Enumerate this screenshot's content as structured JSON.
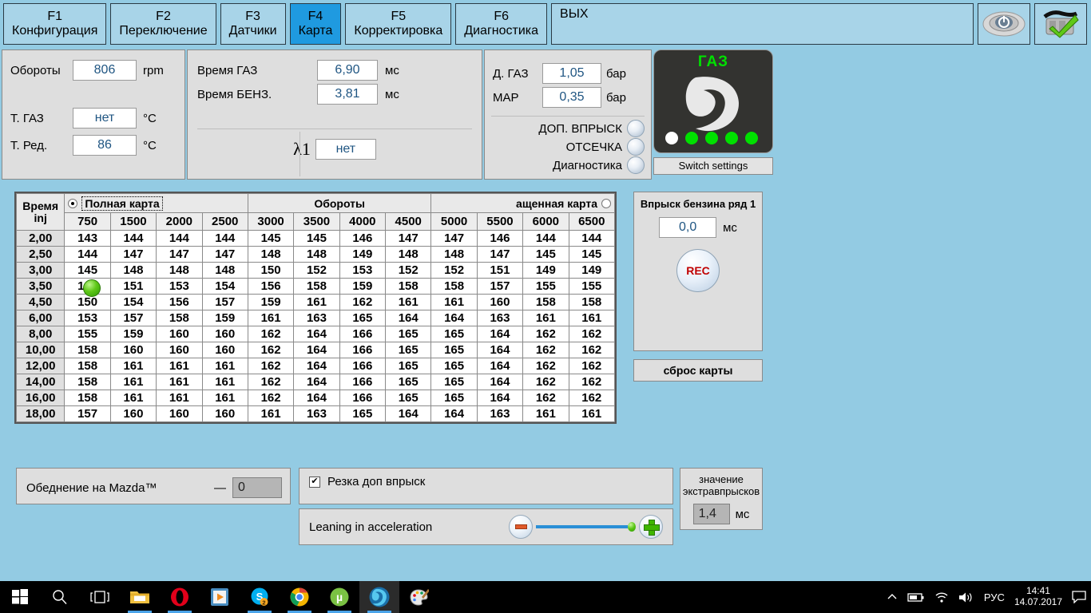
{
  "tabs": [
    {
      "fkey": "F1",
      "name": "Конфигурация",
      "selected": false
    },
    {
      "fkey": "F2",
      "name": "Переключение",
      "selected": false
    },
    {
      "fkey": "F3",
      "name": "Датчики",
      "selected": false
    },
    {
      "fkey": "F4",
      "name": "Карта",
      "selected": true
    },
    {
      "fkey": "F5",
      "name": "Корректировка",
      "selected": false
    },
    {
      "fkey": "F6",
      "name": "Диагностика",
      "selected": false
    }
  ],
  "exit_tab": {
    "label": "ВЫХ"
  },
  "toolbar_icons": [
    {
      "name": "power-button-icon"
    },
    {
      "name": "connector-ok-icon"
    }
  ],
  "params": {
    "rpm": {
      "label": "Обороты",
      "value": "806",
      "unit": "rpm"
    },
    "t_gas": {
      "label": "Т. ГАЗ",
      "value": "нет",
      "unit": "°C"
    },
    "t_red": {
      "label": "Т. Ред.",
      "value": "86",
      "unit": "°C"
    },
    "time_gas": {
      "label": "Время ГАЗ",
      "value": "6,90",
      "unit": "мс"
    },
    "time_petrol": {
      "label": "Время БЕНЗ.",
      "value": "3,81",
      "unit": "мс"
    },
    "lambda": {
      "label": "λ1",
      "value": "нет"
    },
    "p_gas": {
      "label": "Д. ГАЗ",
      "value": "1,05",
      "unit": "бар"
    },
    "map": {
      "label": "МАР",
      "value": "0,35",
      "unit": "бар"
    },
    "lamps": [
      {
        "label": "ДОП. ВПРЫСК",
        "on": false
      },
      {
        "label": "ОТСЕЧКА",
        "on": false
      },
      {
        "label": "Диагностика",
        "on": false
      }
    ]
  },
  "gas_panel": {
    "title": "ГАЗ",
    "logo_icon": "gas-leaf-logo-icon",
    "leds": [
      "white",
      "green",
      "green",
      "green",
      "green"
    ],
    "switch_button": "Switch settings"
  },
  "map_table": {
    "corner_line1": "Время",
    "corner_line2": "inj",
    "full_map_label": "Полная карта",
    "full_map_selected": true,
    "rpm_header": "Обороты",
    "short_map_label": "ащенная карта",
    "short_map_selected": false,
    "columns": [
      "750",
      "1500",
      "2000",
      "2500",
      "3000",
      "3500",
      "4000",
      "4500",
      "5000",
      "5500",
      "6000",
      "6500"
    ],
    "rows": [
      {
        "inj": "2,00",
        "values": [
          "143",
          "144",
          "144",
          "144",
          "145",
          "145",
          "146",
          "147",
          "147",
          "146",
          "144",
          "144"
        ]
      },
      {
        "inj": "2,50",
        "values": [
          "144",
          "147",
          "147",
          "147",
          "148",
          "148",
          "149",
          "148",
          "148",
          "147",
          "145",
          "145"
        ]
      },
      {
        "inj": "3,00",
        "values": [
          "145",
          "148",
          "148",
          "148",
          "150",
          "152",
          "153",
          "152",
          "152",
          "151",
          "149",
          "149"
        ]
      },
      {
        "inj": "3,50",
        "values": [
          "147",
          "151",
          "153",
          "154",
          "156",
          "158",
          "159",
          "158",
          "158",
          "157",
          "155",
          "155"
        ]
      },
      {
        "inj": "4,50",
        "values": [
          "150",
          "154",
          "156",
          "157",
          "159",
          "161",
          "162",
          "161",
          "161",
          "160",
          "158",
          "158"
        ]
      },
      {
        "inj": "6,00",
        "values": [
          "153",
          "157",
          "158",
          "159",
          "161",
          "163",
          "165",
          "164",
          "164",
          "163",
          "161",
          "161"
        ]
      },
      {
        "inj": "8,00",
        "values": [
          "155",
          "159",
          "160",
          "160",
          "162",
          "164",
          "166",
          "165",
          "165",
          "164",
          "162",
          "162"
        ]
      },
      {
        "inj": "10,00",
        "values": [
          "158",
          "160",
          "160",
          "160",
          "162",
          "164",
          "166",
          "165",
          "165",
          "164",
          "162",
          "162"
        ]
      },
      {
        "inj": "12,00",
        "values": [
          "158",
          "161",
          "161",
          "161",
          "162",
          "164",
          "166",
          "165",
          "165",
          "164",
          "162",
          "162"
        ]
      },
      {
        "inj": "14,00",
        "values": [
          "158",
          "161",
          "161",
          "161",
          "162",
          "164",
          "166",
          "165",
          "165",
          "164",
          "162",
          "162"
        ]
      },
      {
        "inj": "16,00",
        "values": [
          "158",
          "161",
          "161",
          "161",
          "162",
          "164",
          "166",
          "165",
          "165",
          "164",
          "162",
          "162"
        ]
      },
      {
        "inj": "18,00",
        "values": [
          "157",
          "160",
          "160",
          "160",
          "161",
          "163",
          "165",
          "164",
          "164",
          "163",
          "161",
          "161"
        ]
      }
    ],
    "marker": {
      "row": 3,
      "col": 0,
      "name": "current-point-marker"
    }
  },
  "side_panel": {
    "title": "Впрыск бензина ряд 1",
    "value": "0,0",
    "unit": "мс",
    "rec_label": "REC",
    "reset_label": "сброс карты"
  },
  "bottom": {
    "mazda_label": "Обеднение на Mazda™",
    "mazda_dash": "—",
    "mazda_value": "0",
    "checkbox_label": "Резка доп впрыск",
    "checkbox_checked": true,
    "checkbox_glyph": "✔",
    "slider_label": "Leaning in acceleration",
    "slider_percent": 92,
    "extra_label_line1": "значение",
    "extra_label_line2": "экстравпрысков",
    "extra_value": "1,4",
    "extra_unit": "мс"
  },
  "taskbar": {
    "items": [
      {
        "name": "start-button",
        "icon": "windows-logo-icon"
      },
      {
        "name": "search-button",
        "icon": "search-icon"
      },
      {
        "name": "task-view-button",
        "icon": "task-view-icon"
      },
      {
        "name": "file-explorer-button",
        "icon": "folder-icon"
      },
      {
        "name": "opera-button",
        "icon": "opera-icon"
      },
      {
        "name": "media-player-button",
        "icon": "media-player-icon"
      },
      {
        "name": "skype-button",
        "icon": "skype-icon",
        "badge": "2"
      },
      {
        "name": "chrome-button",
        "icon": "chrome-icon"
      },
      {
        "name": "utorrent-button",
        "icon": "utorrent-icon"
      },
      {
        "name": "gas-software-button",
        "icon": "gas-app-icon",
        "active": true
      },
      {
        "name": "paint-button",
        "icon": "paint-icon"
      }
    ],
    "tray": {
      "chevron": "show-hidden-icons",
      "battery": "battery-icon",
      "network": "wifi-icon",
      "volume": "volume-icon",
      "language": "РУС",
      "time": "14:41",
      "date": "14.07.2017",
      "action_center": "notifications-icon"
    }
  },
  "colors": {
    "background": "#93cbe3",
    "tab": "#a8d4e8",
    "tab_selected": "#1f9ae0",
    "panel": "#dedede",
    "field_text": "#1f5582",
    "led_green": "#00e000",
    "accent_blue": "#2a8fd6"
  }
}
